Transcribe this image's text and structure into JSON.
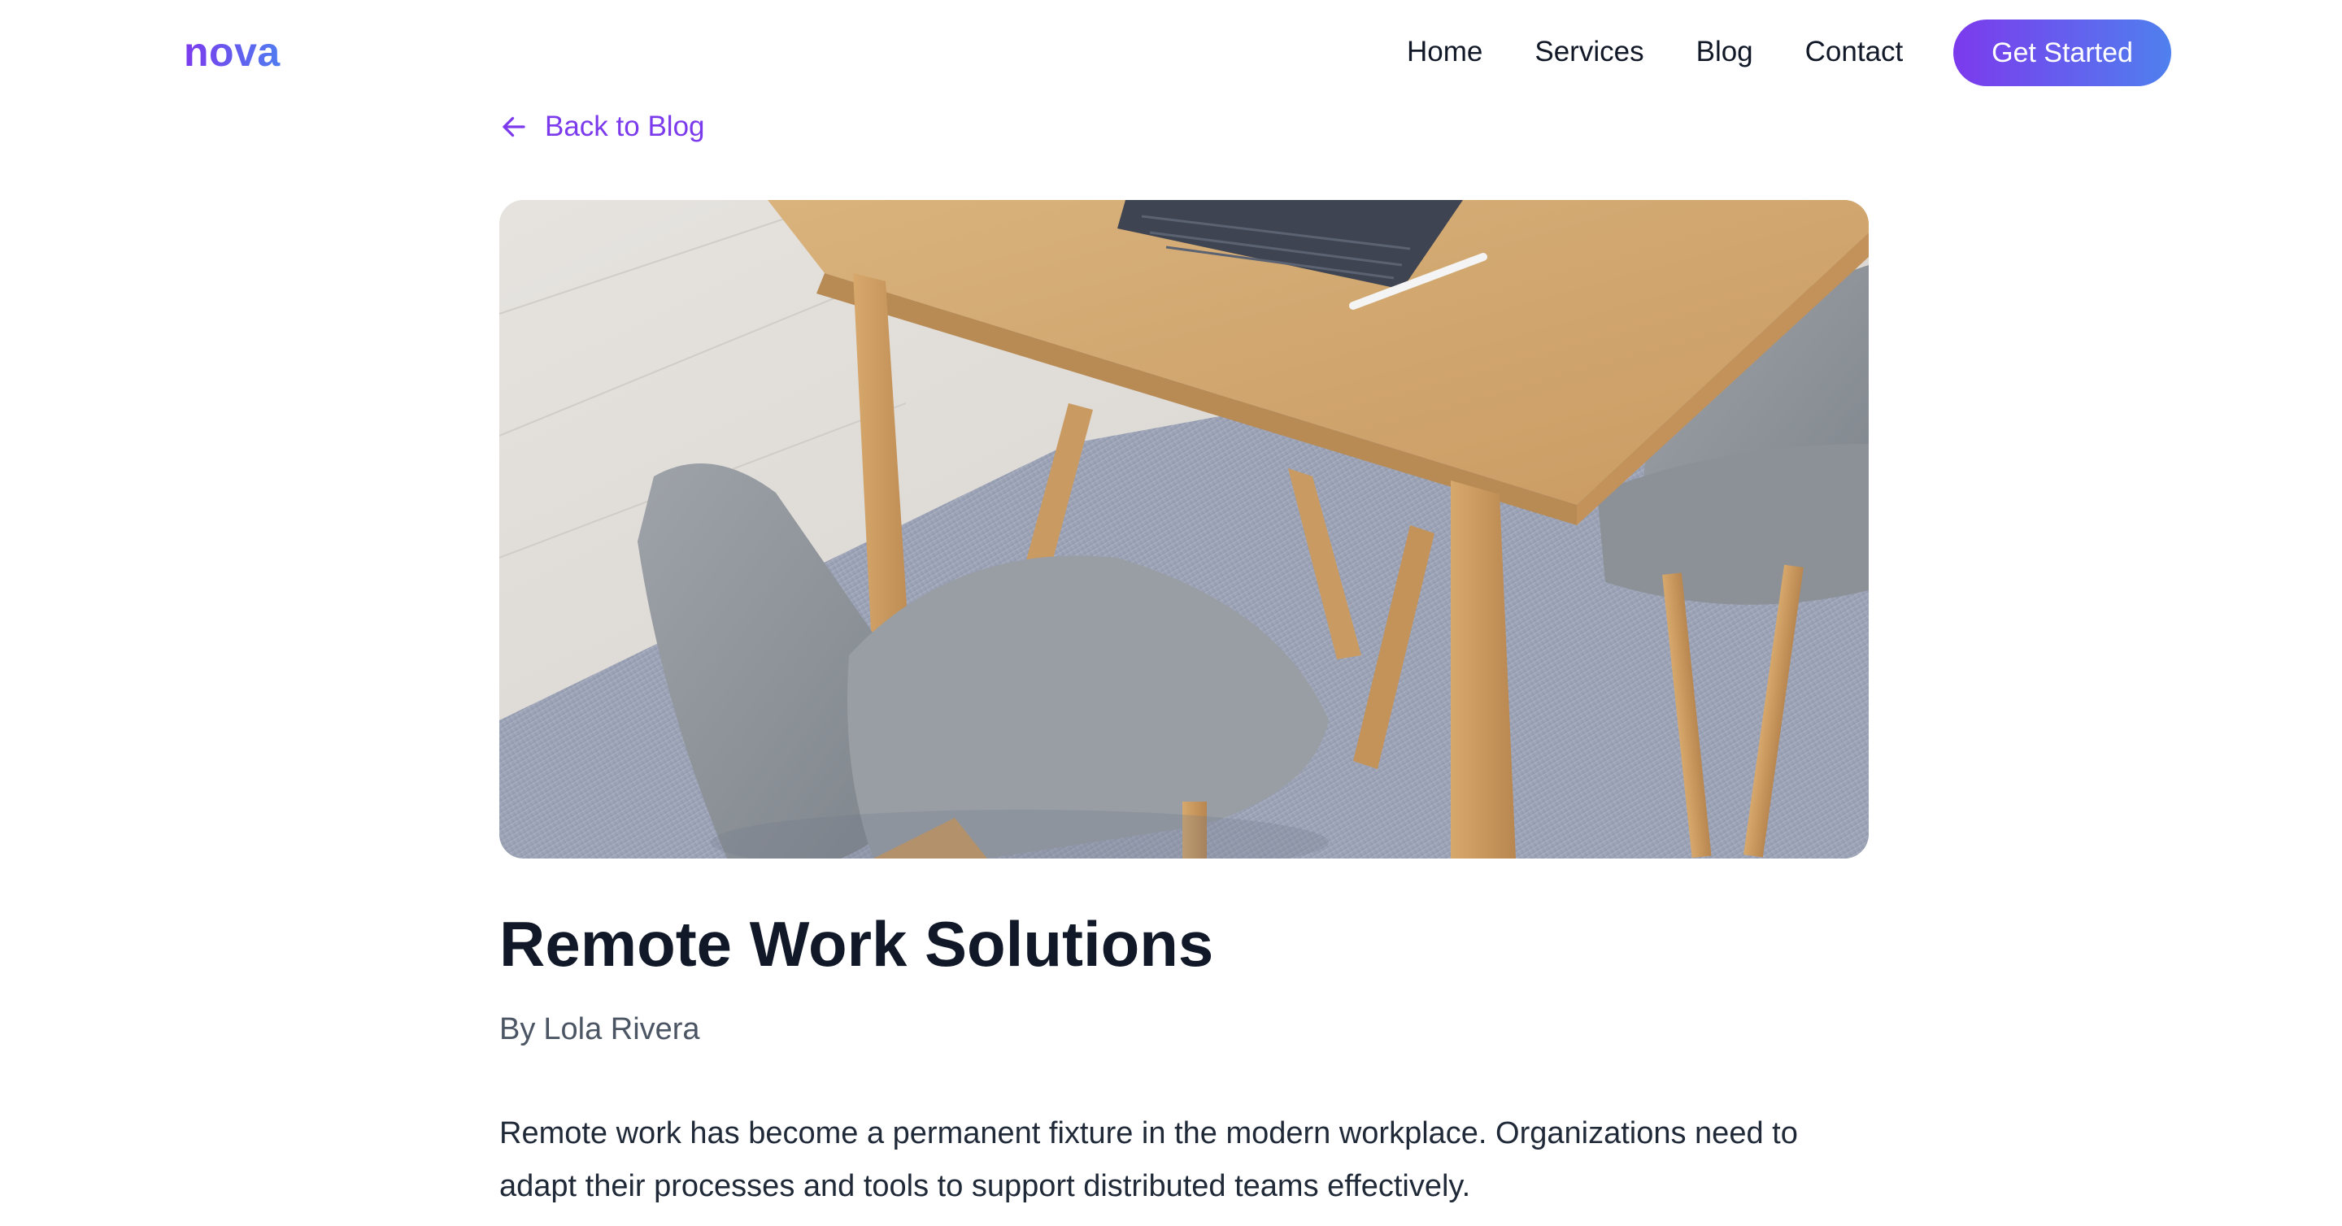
{
  "header": {
    "logo": "nova",
    "nav": [
      {
        "label": "Home"
      },
      {
        "label": "Services"
      },
      {
        "label": "Blog"
      },
      {
        "label": "Contact"
      }
    ],
    "cta_label": "Get Started"
  },
  "back_link": {
    "label": "Back to Blog",
    "icon": "arrow-left-icon"
  },
  "hero_image": {
    "subject": "hero-image"
  },
  "article": {
    "title": "Remote Work Solutions",
    "byline_prefix": "By",
    "author": "Lola Rivera",
    "body": "Remote work has become a permanent fixture in the modern workplace. Organizations need to adapt their processes and tools to support distributed teams effectively."
  },
  "colors": {
    "accent": "#7c3aed",
    "accent_gradient_end": "#4f80ee",
    "title": "#111827",
    "byline": "#4b5563",
    "body": "#1f2937"
  }
}
